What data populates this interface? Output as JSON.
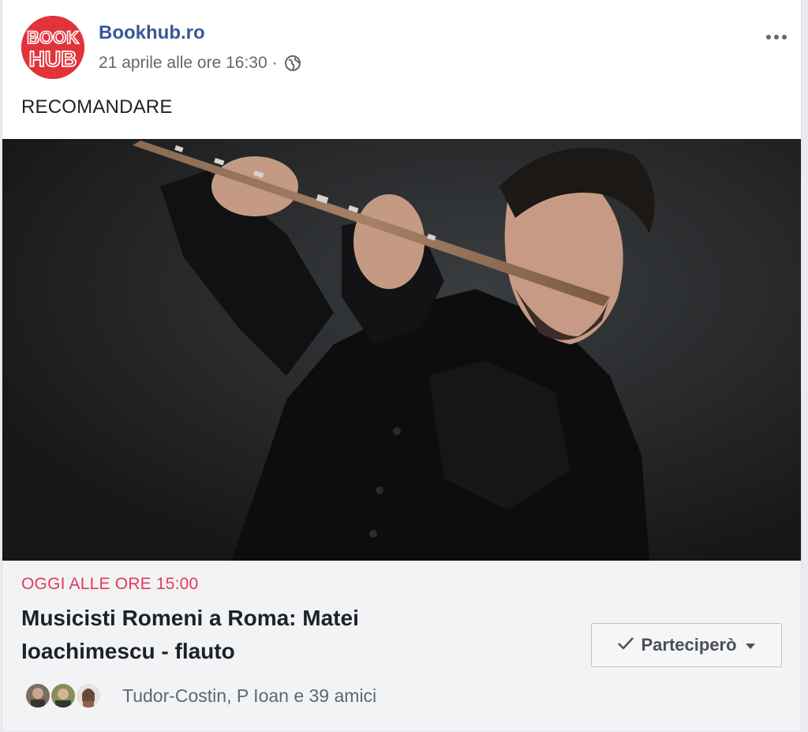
{
  "post": {
    "page_name": "Bookhub.ro",
    "timestamp": "21 aprile alle ore 16:30",
    "separator": "·",
    "privacy_icon": "globe-icon",
    "menu_icon": "more-options-icon",
    "text": "RECOMANDARE",
    "logo": {
      "line1": "BOOK",
      "line2": "HUB",
      "color": "#e2333b"
    }
  },
  "event": {
    "date": "OGGI ALLE ORE 15:00",
    "title": "Musicisti Romeni a Roma: Matei Ioachimescu - flauto",
    "going_label": "Parteciperò",
    "friends_text": "Tudor-Costin, P Ioan e 39 amici",
    "friend_avatar_count": 3
  },
  "colors": {
    "link": "#385898",
    "date_accent": "#e5395a",
    "muted": "#606770"
  }
}
